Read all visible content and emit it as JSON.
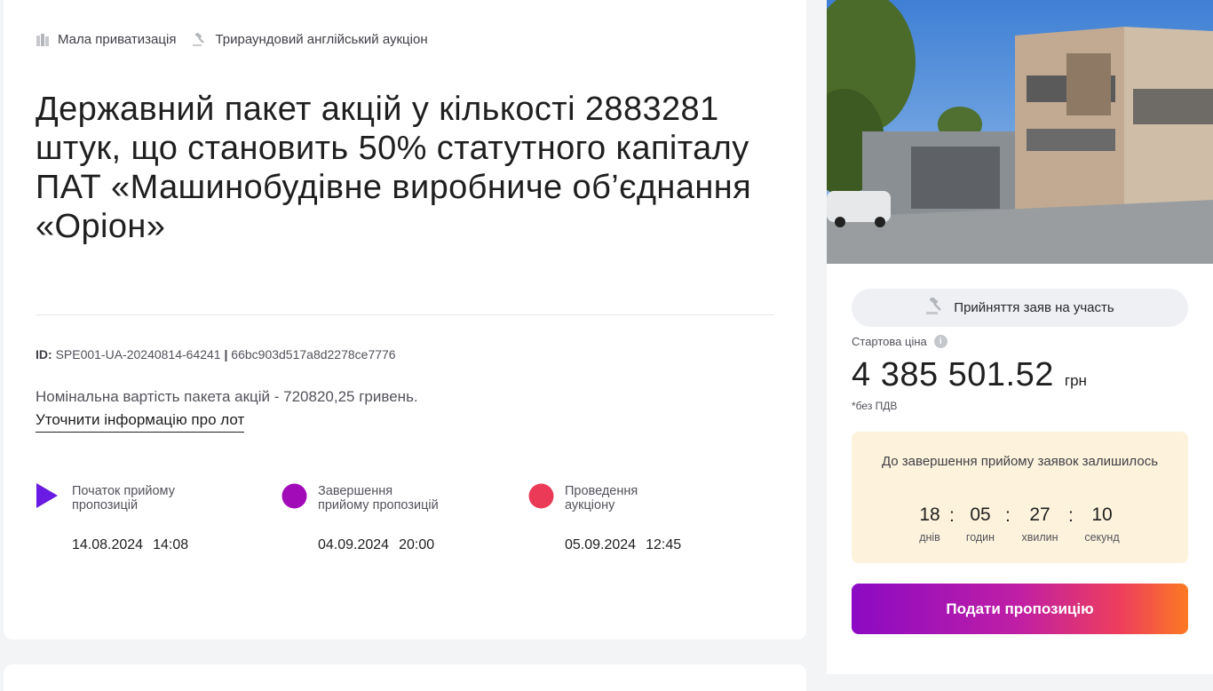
{
  "tags": [
    {
      "label": "Мала приватизація",
      "icon": "building-icon"
    },
    {
      "label": "Трираундовий англійський аукціон",
      "icon": "gavel-icon"
    }
  ],
  "lot": {
    "title": "Державний пакет акцій у кількості 2883281 штук, що становить 50% статутного капіталу ПАТ «Машинобудівне виробниче об’єднання «Оріон»",
    "id_label": "ID:",
    "id_value": "SPE001-UA-20240814-64241",
    "id_separator": "|",
    "hash": "66bc903d517a8d2278ce7776",
    "description": "Номінальна вартість пакета акцій - 720820,25 гривень.",
    "more_link": "Уточнити інформацію про лот"
  },
  "stages": [
    {
      "label": "Початок прийому пропозицій",
      "date": "14.08.2024",
      "time": "14:08",
      "color": "#6a1be3"
    },
    {
      "label": "Завершення прийому пропозицій",
      "date": "04.09.2024",
      "time": "20:00",
      "color": "#a10bb8"
    },
    {
      "label": "Проведення аукціону",
      "date": "05.09.2024",
      "time": "12:45",
      "color": "#ea3a57"
    }
  ],
  "sidebar": {
    "status": "Прийняття заяв на участь",
    "price_label": "Стартова ціна",
    "price": "4 385 501.52",
    "currency": "грн",
    "price_note": "*без ПДВ",
    "countdown_title": "До завершення прийому заявок залишилось",
    "timer": [
      {
        "value": "18",
        "unit": "днів"
      },
      {
        "value": "05",
        "unit": "годин"
      },
      {
        "value": "27",
        "unit": "хвилин"
      },
      {
        "value": "10",
        "unit": "секунд"
      }
    ],
    "timer_separator": ":",
    "submit_label": "Подати пропозицію"
  },
  "colors": {
    "accent_purple": "#8b0ac4",
    "accent_orange": "#fb7a22",
    "countdown_bg": "#fdf3dc"
  }
}
